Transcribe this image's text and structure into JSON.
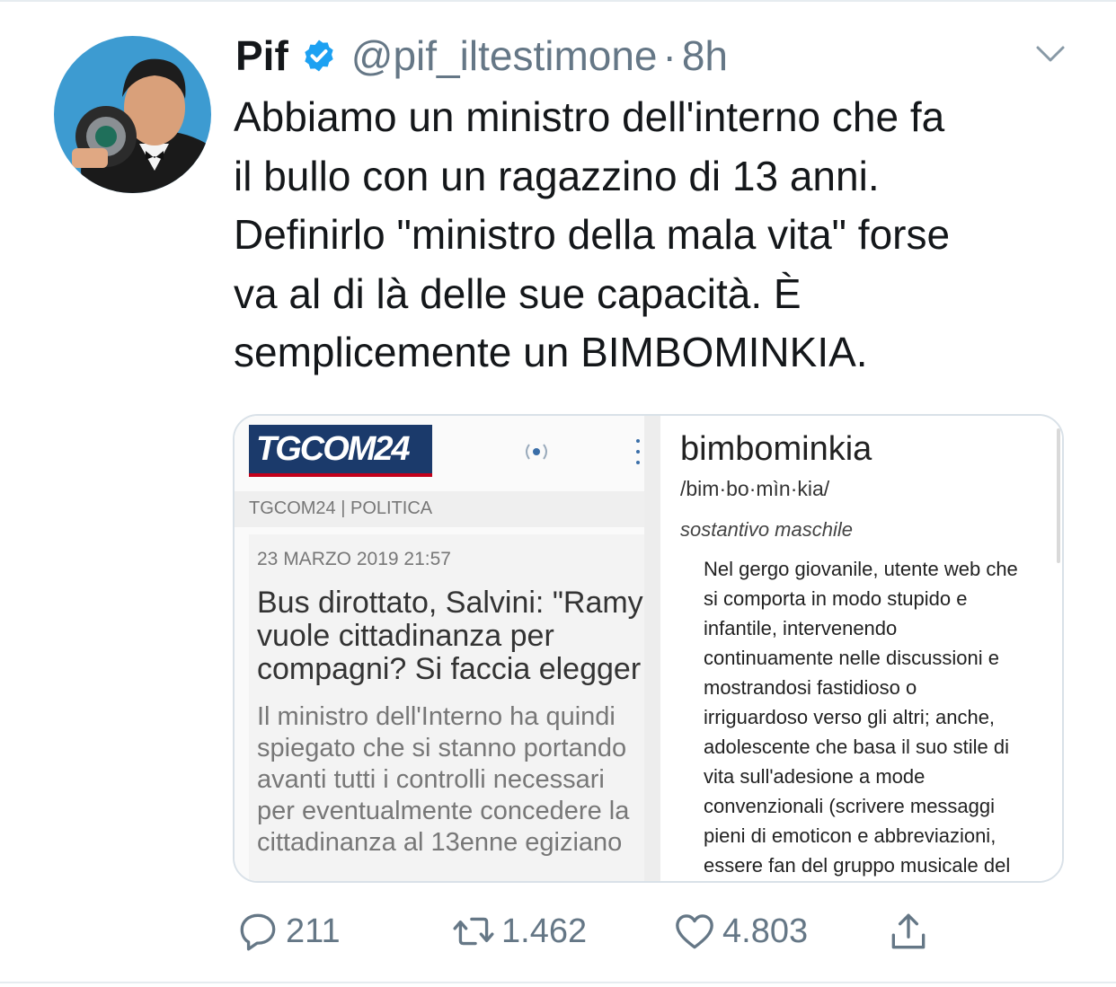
{
  "tweet": {
    "display_name": "Pif",
    "handle": "@pif_iltestimone",
    "separator": "·",
    "time": "8h",
    "text_lines": [
      "Abbiamo un ministro dell'interno che fa",
      "il bullo con un ragazzino di 13 anni.",
      "Definirlo \"ministro della mala vita\" forse",
      "va al di là delle sue capacità. È",
      "semplicemente un BIMBOMINKIA."
    ]
  },
  "media": {
    "left": {
      "logo": "TGCOM24",
      "section": "TGCOM24 | POLITICA",
      "date": "23 MARZO 2019 21:57",
      "title_lines": [
        "Bus dirottato, Salvini: \"Ramy",
        "vuole cittadinanza per",
        "compagni? Si faccia elegger"
      ],
      "summary_lines": [
        "Il ministro dell'Interno ha quindi",
        "spiegato che si stanno portando",
        "avanti tutti i controlli necessari",
        "per eventualmente concedere la",
        "cittadinanza al 13enne egiziano"
      ]
    },
    "right": {
      "word": "bimbominkia",
      "phonetic": "/bim·bo·mìn·kia/",
      "part_of_speech": "sostantivo maschile",
      "definition_lines": [
        "Nel gergo giovanile, utente web che",
        "si comporta in modo stupido e",
        "infantile, intervenendo",
        "continuamente nelle discussioni e",
        "mostrandosi fastidioso o",
        "irriguardoso verso gli altri; anche,",
        "adolescente che basa il suo stile di",
        "vita sull'adesione a mode",
        "convenzionali (scrivere messaggi",
        "pieni di emoticon e abbreviazioni,",
        "essere fan del gruppo musicale del"
      ]
    }
  },
  "actions": {
    "replies": "211",
    "retweets": "1.462",
    "likes": "4.803"
  },
  "icons": {
    "reply": "reply-icon",
    "retweet": "retweet-icon",
    "like": "heart-icon",
    "share": "share-icon",
    "verified": "verified-badge-icon",
    "more": "chevron-down-icon"
  },
  "colors": {
    "verified": "#1da1f2",
    "secondary_text": "#657786",
    "primary_text": "#14171a"
  }
}
